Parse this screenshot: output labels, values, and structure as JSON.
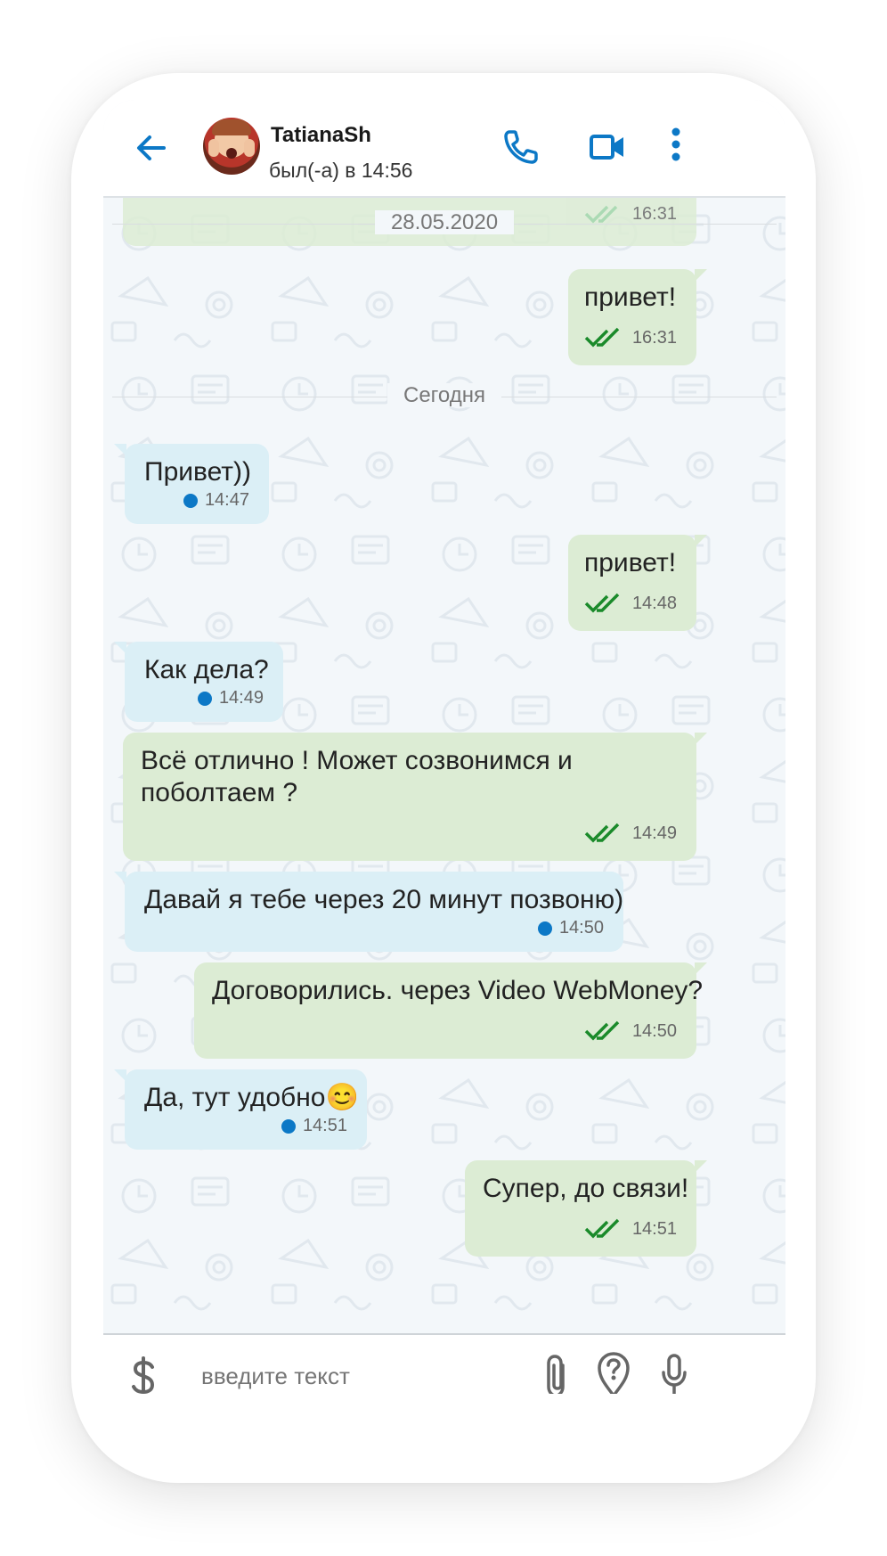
{
  "header": {
    "contact_name": "TatianaSh",
    "status": "был(-а) в 14:56"
  },
  "separators": {
    "first_date": "28.05.2020",
    "today": "Сегодня"
  },
  "prev_message_time": "16:31",
  "messages": [
    {
      "dir": "out",
      "text": "привет!",
      "time": "16:31",
      "status": "read"
    },
    {
      "dir": "in",
      "text": "Привет))",
      "time": "14:47"
    },
    {
      "dir": "out",
      "text": "привет!",
      "time": "14:48",
      "status": "read"
    },
    {
      "dir": "in",
      "text": "Как дела?",
      "time": "14:49"
    },
    {
      "dir": "out",
      "text_line1": "Всё отлично ! Может созвонимся и",
      "text_line2": "поболтаем ?",
      "time": "14:49",
      "status": "read"
    },
    {
      "dir": "in",
      "text": "Давай я тебе через 20 минут позвоню)",
      "time": "14:50"
    },
    {
      "dir": "out",
      "text": "Договорились. через Video WebMoney?",
      "time": "14:50",
      "status": "read"
    },
    {
      "dir": "in",
      "text": "Да, тут удобно😊",
      "time": "14:51"
    },
    {
      "dir": "out",
      "text": "Супер, до связи!",
      "time": "14:51",
      "status": "read"
    }
  ],
  "composer": {
    "placeholder": "введите текст"
  },
  "colors": {
    "accent": "#0c78c6",
    "incoming_bubble": "#dbeff6",
    "outgoing_bubble": "#dcecd4",
    "check_green": "#1a8a2a"
  },
  "icons": [
    "back-arrow-icon",
    "phone-icon",
    "video-camera-icon",
    "more-vertical-icon",
    "dollar-icon",
    "paperclip-icon",
    "location-question-icon",
    "microphone-icon",
    "double-check-icon",
    "unread-dot-icon"
  ]
}
